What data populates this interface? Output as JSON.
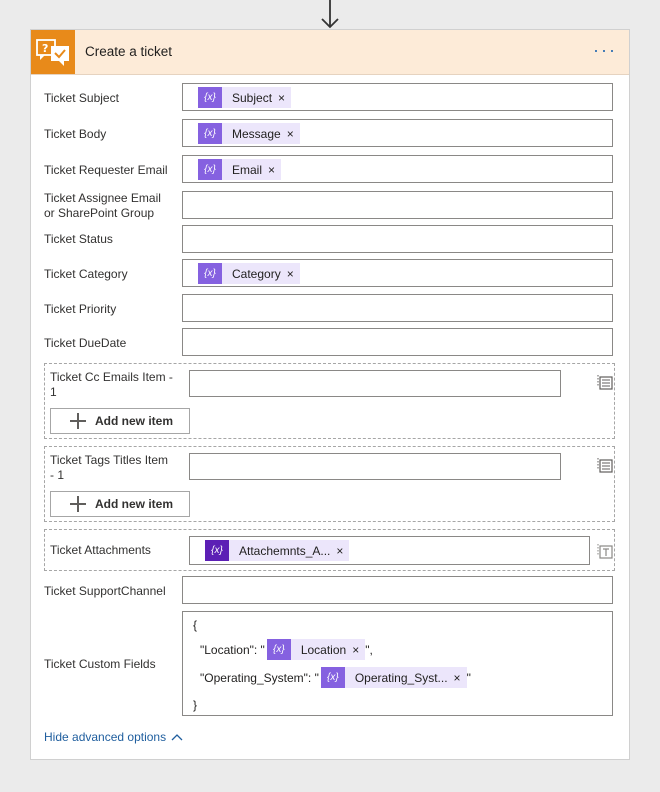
{
  "action": {
    "title": "Create a ticket",
    "more_label": "···",
    "icon": "help-desk-icon",
    "accent": "#e88a1a"
  },
  "fields": {
    "subject": {
      "label": "Ticket Subject",
      "token": "Subject"
    },
    "body": {
      "label": "Ticket Body",
      "token": "Message"
    },
    "requester": {
      "label": "Ticket Requester Email",
      "token": "Email"
    },
    "assignee": {
      "label": "Ticket Assignee Email or SharePoint Group"
    },
    "status": {
      "label": "Ticket Status"
    },
    "category": {
      "label": "Ticket Category",
      "token": "Category"
    },
    "priority": {
      "label": "Ticket Priority"
    },
    "duedate": {
      "label": "Ticket DueDate"
    },
    "cc": {
      "label": "Ticket Cc Emails Item - 1",
      "add_label": "Add new item"
    },
    "tags": {
      "label": "Ticket Tags Titles Item - 1",
      "add_label": "Add new item"
    },
    "attachments": {
      "label": "Ticket Attachments",
      "token": "Attachemnts_A..."
    },
    "support_channel": {
      "label": "Ticket SupportChannel"
    },
    "custom": {
      "label": "Ticket Custom Fields",
      "open": "{",
      "close": "}",
      "line1_prefix": "\"Location\": \"",
      "line1_token": "Location",
      "line1_suffix": "\",",
      "line2_prefix": "\"Operating_System\": \"",
      "line2_token": "Operating_Syst...",
      "line2_suffix": "\""
    }
  },
  "token_glyph": "{x}",
  "close_glyph": "×",
  "hide_label": "Hide advanced options"
}
